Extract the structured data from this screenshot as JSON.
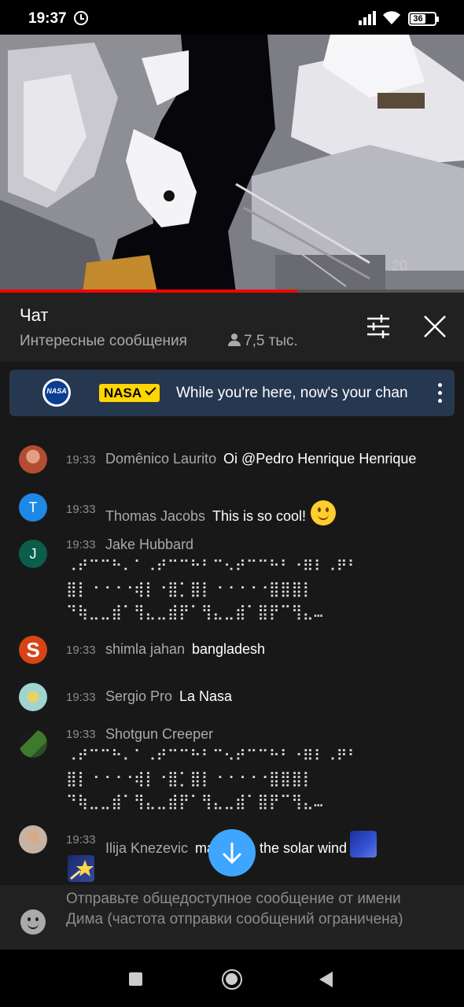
{
  "status_bar": {
    "time": "19:37",
    "battery": "36",
    "battery_fraction": 0.36,
    "icons": [
      "alarm-icon",
      "signal-icon",
      "wifi-icon",
      "battery-icon"
    ]
  },
  "video": {
    "watermark": "20",
    "progress_fraction": 0.64,
    "colors": {
      "progress": "#ff0000",
      "track": "#555555"
    }
  },
  "chat_header": {
    "title": "Чат",
    "filter": "Интересные сообщения",
    "viewers": "7,5 тыс.",
    "icons": [
      "person-icon",
      "settings-icon",
      "close-icon"
    ]
  },
  "pinned": {
    "logo_text": "NASA",
    "badge": "NASA",
    "text": "While you're here, now's your chance",
    "colors": {
      "background": "#263850",
      "badge": "#ffd600"
    }
  },
  "messages": [
    {
      "time": "19:33",
      "author": "Domênico Laurito",
      "text": "Oi @Pedro Henrique Henrique",
      "avatar": "photo",
      "avatar_color": "#b44c33"
    },
    {
      "time": "19:33",
      "author": "Thomas Jacobs",
      "text": "This is so cool!",
      "avatar_letter": "T",
      "avatar_color": "#1e88e5",
      "emoji": "slightly-smiling-face"
    },
    {
      "time": "19:33",
      "author": "Jake Hubbard",
      "avatar_letter": "J",
      "avatar_color": "#0b5e4c",
      "lines": [
        "⠠⠞⠉⠉⠓⠄⠁⠠⠞⠉⠉⠓⠃⠉⠢⠞⠉⠉⠓⠃⠐⠿⠇⠠⠟⠃",
        "⣿⡇⠐⠐⠐⠐⢾⡇⠐⣿⡁⣿⡇⠐⠐⠐⠐⠐⣿⣿⣿⡇",
        "⠙⢷⣀⣀⣾⠁⢻⣄⣀⣾⡟⠁⢻⣄⣀⣾⠁⣿⡟⠉⢻⣄…"
      ]
    },
    {
      "time": "19:33",
      "author": "shimla jahan",
      "text": "bangladesh",
      "avatar_letter": "S",
      "avatar_color": "#d84315"
    },
    {
      "time": "19:33",
      "author": "Sergio Pro",
      "text": "La Nasa",
      "avatar": "photo",
      "avatar_color": "#9fd4d1"
    },
    {
      "time": "19:33",
      "author": "Shotgun Creeper",
      "avatar": "photo",
      "avatar_color": "#2e4d25",
      "lines": [
        "⠠⠞⠉⠉⠓⠄⠁⠠⠞⠉⠉⠓⠃⠉⠢⠞⠉⠉⠓⠃⠐⠿⠇⠠⠟⠃",
        "⣿⡇⠐⠐⠐⠐⢾⡇⠐⣿⡁⣿⡇⠐⠐⠐⠐⠐⣿⣿⣿⡇",
        "⠙⢷⣀⣀⣾⠁⢻⣄⣀⣾⡟⠁⢻⣄⣀⣾⠁⣿⡟⠉⢻⣄…"
      ]
    },
    {
      "time": "19:33",
      "author": "Ilija Knezevic",
      "text": "maybe its the solar wind",
      "avatar": "photo",
      "avatar_color": "#c7b3a3",
      "stickers": [
        "eu-flag-sticker",
        "shooting-star-sticker"
      ]
    }
  ],
  "input": {
    "placeholder": "Отправьте общедоступное сообщение от имени Дима (частота отправки сообщений ограничена)"
  },
  "nav_bar": {
    "icons": [
      "recent-apps-icon",
      "home-icon",
      "back-icon"
    ]
  },
  "scroll_down": {
    "icon": "arrow-down-icon",
    "color": "#3ea6ff"
  }
}
